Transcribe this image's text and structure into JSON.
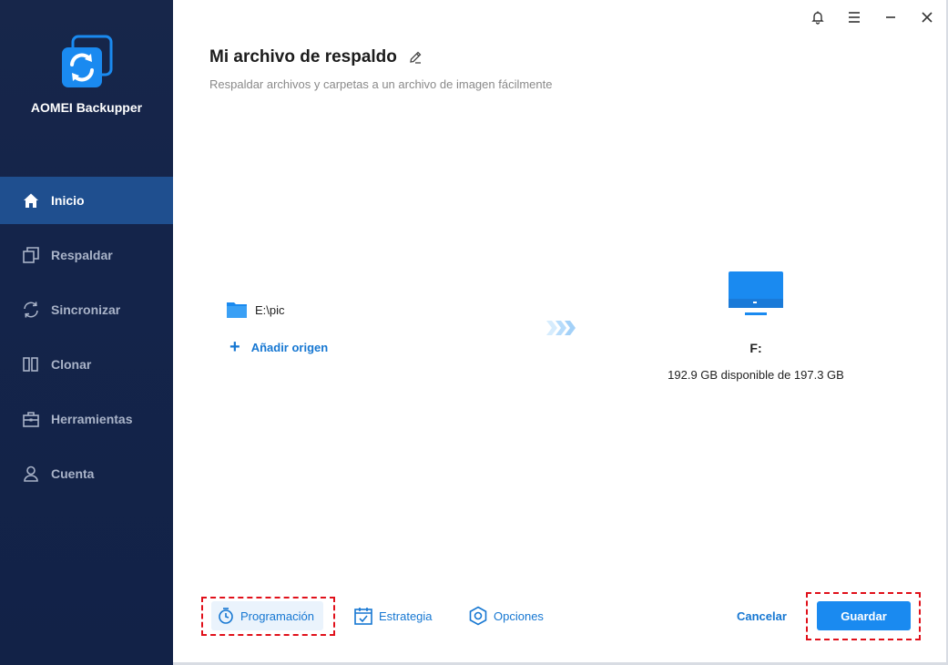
{
  "app": {
    "name": "AOMEI Backupper"
  },
  "sidebar": {
    "items": [
      {
        "label": "Inicio",
        "icon": "home-icon",
        "active": true
      },
      {
        "label": "Respaldar",
        "icon": "copy-icon",
        "active": false
      },
      {
        "label": "Sincronizar",
        "icon": "sync-icon",
        "active": false
      },
      {
        "label": "Clonar",
        "icon": "clone-icon",
        "active": false
      },
      {
        "label": "Herramientas",
        "icon": "toolbox-icon",
        "active": false
      },
      {
        "label": "Cuenta",
        "icon": "user-icon",
        "active": false
      }
    ]
  },
  "header": {
    "title": "Mi archivo de respaldo",
    "subtitle": "Respaldar archivos y carpetas a un archivo de imagen fácilmente"
  },
  "source": {
    "item": "E:\\pic",
    "add_label": "Añadir origen"
  },
  "destination": {
    "drive": "F:",
    "space": "192.9 GB disponible de 197.3 GB"
  },
  "footer": {
    "schedule_label": "Programación",
    "strategy_label": "Estrategia",
    "options_label": "Opciones",
    "cancel_label": "Cancelar",
    "save_label": "Guardar"
  },
  "colors": {
    "sidebar_bg": "#14244a",
    "active_item": "#1f4f8f",
    "accent": "#1677d2",
    "save_button": "#1a8af0",
    "highlight": "#e0101a"
  }
}
